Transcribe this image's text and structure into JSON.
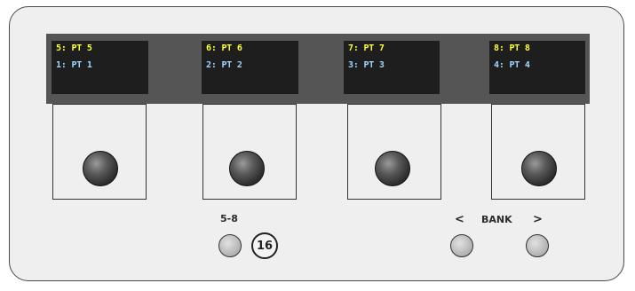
{
  "colors": {
    "primary_text": "#ffff33",
    "secondary_text": "#9fd7ff"
  },
  "channels": [
    {
      "top": "5: PT 5",
      "bottom": "1: PT 1"
    },
    {
      "top": "6: PT 6",
      "bottom": "2: PT 2"
    },
    {
      "top": "7: PT 7",
      "bottom": "3: PT 3"
    },
    {
      "top": "8: PT 8",
      "bottom": "4: PT 4"
    }
  ],
  "controls": {
    "bank_select_label": "5-8",
    "channel_count_badge": "16",
    "bank_prev_label": "<",
    "bank_label": "BANK",
    "bank_next_label": ">"
  }
}
